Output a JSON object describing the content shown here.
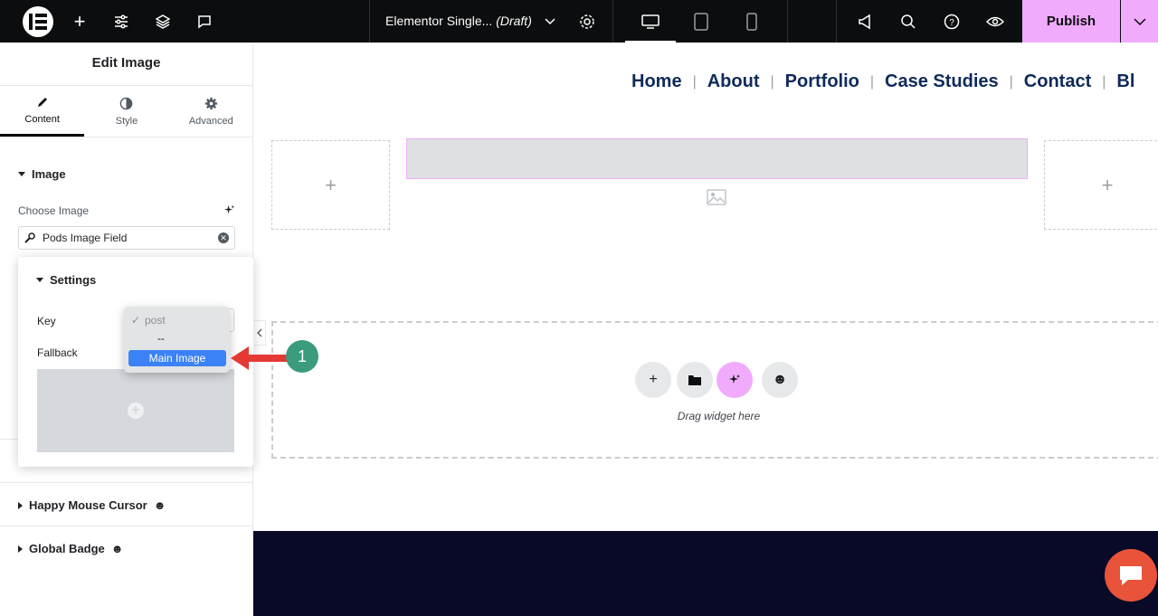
{
  "topbar": {
    "document_title": "Elementor Single...",
    "document_status": "(Draft)",
    "publish_label": "Publish"
  },
  "panel": {
    "title": "Edit Image",
    "tabs": [
      {
        "label": "Content",
        "icon": "pencil-icon",
        "active": true
      },
      {
        "label": "Style",
        "icon": "half-circle-icon",
        "active": false
      },
      {
        "label": "Advanced",
        "icon": "gear-icon",
        "active": false
      }
    ],
    "image_section": "Image",
    "choose_image_label": "Choose Image",
    "dynamic_field_value": "Pods Image Field",
    "sections": [
      "Happy Mouse Cursor",
      "Global Badge"
    ]
  },
  "settings_popover": {
    "title": "Settings",
    "key_label": "Key",
    "fallback_label": "Fallback"
  },
  "dropdown": {
    "options": [
      "post",
      "--",
      "Main Image"
    ],
    "checked": "post",
    "highlighted": "Main Image"
  },
  "annotation": {
    "step": "1"
  },
  "canvas": {
    "nav_items": [
      "Home",
      "About",
      "Portfolio",
      "Case Studies",
      "Contact",
      "Bl"
    ],
    "drag_hint": "Drag widget here"
  },
  "colors": {
    "accent": "#f0abfc",
    "topbar": "#0c0d0e",
    "footer": "#080a27",
    "arrow": "#e53935",
    "badge": "#3a9b7f",
    "chat": "#e8533a"
  }
}
